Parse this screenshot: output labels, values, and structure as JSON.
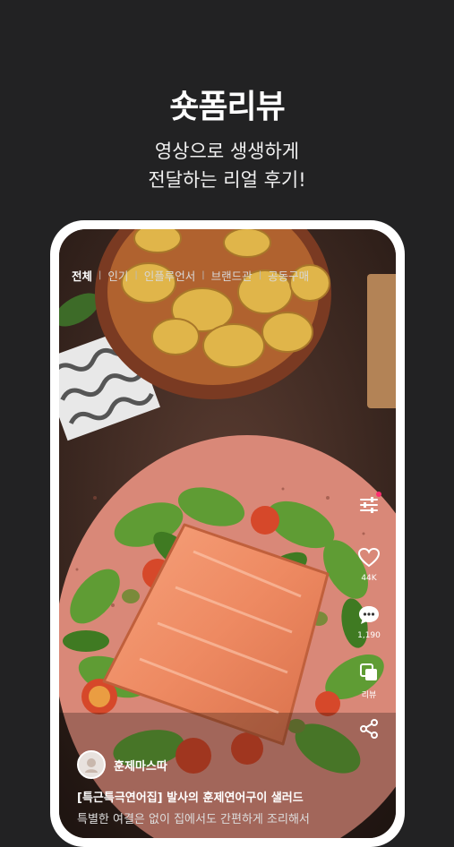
{
  "hero": {
    "title": "숏폼리뷰",
    "subtitle_line1": "영상으로 생생하게",
    "subtitle_line2": "전달하는 리얼 후기!"
  },
  "tabs": [
    {
      "label": "전체",
      "active": true
    },
    {
      "label": "인기"
    },
    {
      "label": "인플루언서"
    },
    {
      "label": "브랜드관"
    },
    {
      "label": "공동구매"
    }
  ],
  "actions": {
    "like_count": "44K",
    "comment_count": "1,190",
    "review_label": "리뷰"
  },
  "post": {
    "author": "훈제마스따",
    "caption": "[특근특극연어집] 발사의 훈제연어구이 샐러드",
    "caption_line2": "특별한 여결은 없이 집에서도 간편하게 조리해서"
  },
  "colors": {
    "background": "#222223",
    "notification_dot": "#ff2d6f",
    "plate": "#d98878"
  }
}
